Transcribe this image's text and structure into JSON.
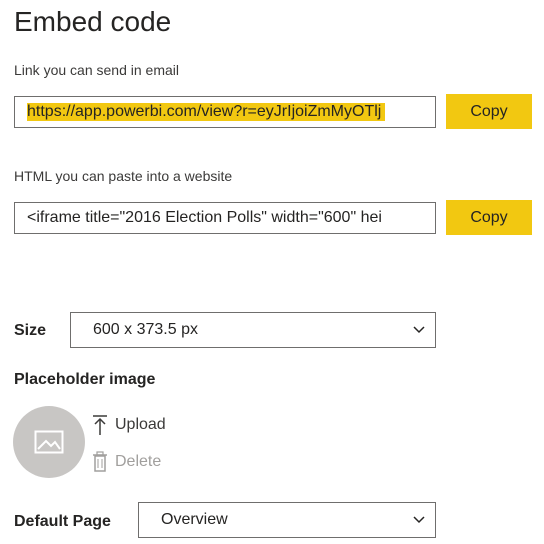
{
  "header": {
    "title": "Embed code"
  },
  "email_link": {
    "label": "Link you can send in email",
    "value": "https://app.powerbi.com/view?r=eyJrIjoiZmMyOTlj",
    "copy_label": "Copy"
  },
  "html_embed": {
    "label": "HTML you can paste into a website",
    "value": "<iframe title=\"2016 Election Polls\" width=\"600\" hei",
    "copy_label": "Copy"
  },
  "size": {
    "label": "Size",
    "selected": "600 x 373.5 px"
  },
  "placeholder": {
    "label": "Placeholder image",
    "upload_label": "Upload",
    "delete_label": "Delete"
  },
  "default_page": {
    "label": "Default Page",
    "selected": "Overview"
  },
  "colors": {
    "accent": "#f2c811",
    "placeholder_circle": "#c8c6c4",
    "disabled_text": "#a19f9d"
  }
}
